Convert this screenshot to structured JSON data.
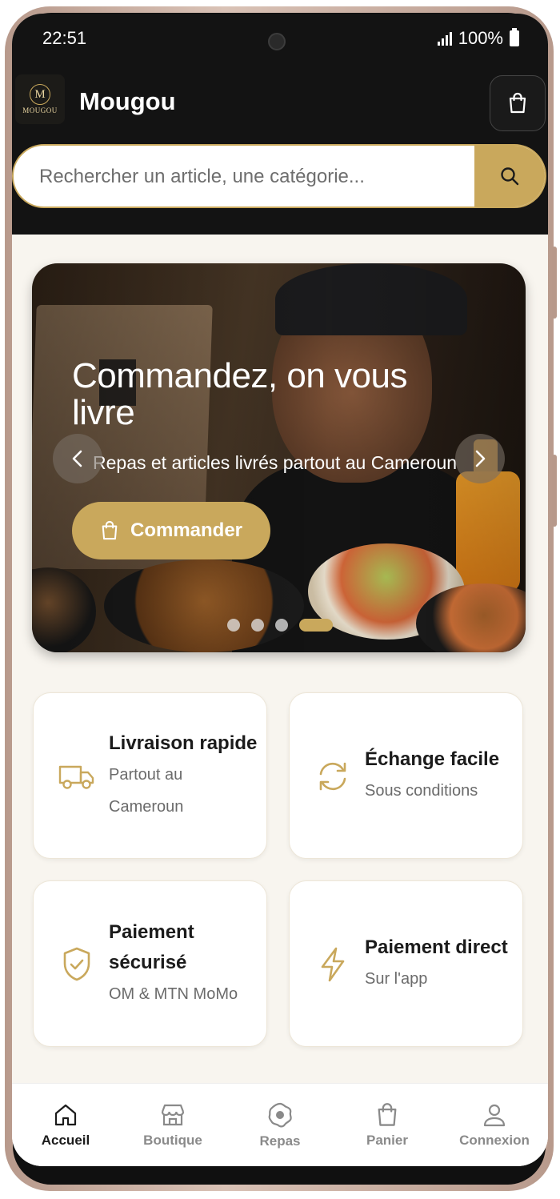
{
  "status_bar": {
    "time": "22:51",
    "battery": "100%"
  },
  "header": {
    "logo_text": "MOUGOU",
    "logo_letter": "M",
    "brand": "Mougou",
    "cart_icon": "shopping-bag-icon"
  },
  "search": {
    "placeholder": "Rechercher un article, une catégorie...",
    "value": "",
    "icon": "search-icon"
  },
  "hero": {
    "title": "Commandez, on vous livre",
    "subtitle": "Repas et articles livrés partout au Cameroun",
    "cta_label": "Commander",
    "slide_count": 4,
    "active_slide": 4
  },
  "features": [
    {
      "title": "Livraison rapide",
      "subtitle": "Partout au Cameroun",
      "icon": "truck-icon"
    },
    {
      "title": "Échange facile",
      "subtitle": "Sous conditions",
      "icon": "refresh-icon"
    },
    {
      "title": "Paiement sécurisé",
      "subtitle": "OM & MTN MoMo",
      "icon": "shield-check-icon"
    },
    {
      "title": "Paiement direct",
      "subtitle": "Sur l'app",
      "icon": "lightning-icon"
    }
  ],
  "nav": [
    {
      "label": "Accueil",
      "icon": "home-icon",
      "active": true
    },
    {
      "label": "Boutique",
      "icon": "store-icon",
      "active": false
    },
    {
      "label": "Repas",
      "icon": "meal-icon",
      "active": false
    },
    {
      "label": "Panier",
      "icon": "shopping-bag-icon",
      "active": false
    },
    {
      "label": "Connexion",
      "icon": "user-icon",
      "active": false
    }
  ],
  "colors": {
    "accent": "#c9a85c",
    "header_bg": "#131313",
    "page_bg": "#f8f5ef"
  }
}
